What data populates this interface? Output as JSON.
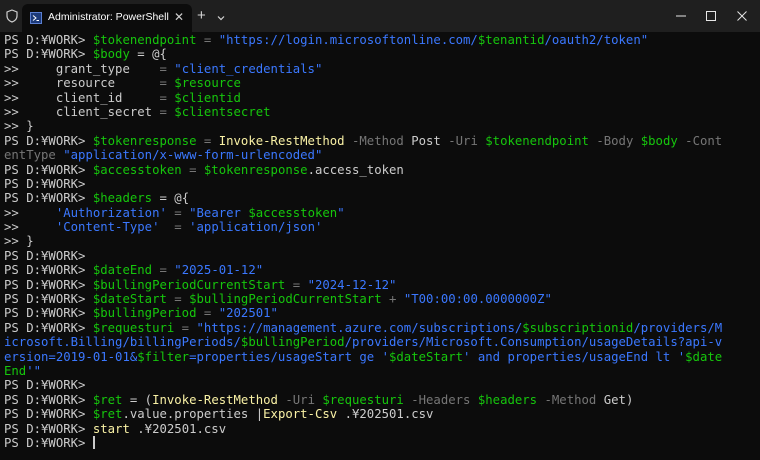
{
  "titlebar": {
    "tab_title": "Administrator: PowerShell",
    "tab_close": "✕",
    "new_tab": "+",
    "icons": {
      "shield": "shield-icon",
      "powershell": "powershell-icon",
      "dropdown": "chevron-down-icon",
      "minimize": "minimize-icon",
      "maximize": "maximize-icon",
      "close": "close-icon"
    }
  },
  "colors": {
    "background": "#0c0c0c",
    "default_text": "#cccccc",
    "variable": "#16c60c",
    "string": "#3b78ff",
    "parameter": "#767676",
    "command": "#f9f1a5",
    "operator": "#767676"
  },
  "terminal": {
    "lines": [
      [
        [
          "PS D:¥WORK> ",
          "p"
        ],
        [
          "$tokenendpoint",
          "v"
        ],
        [
          " = ",
          "o"
        ],
        [
          "\"https://login.microsoftonline.com/",
          "s"
        ],
        [
          "$tenantid",
          "v"
        ],
        [
          "/oauth2/token\"",
          "s"
        ]
      ],
      [
        [
          "PS D:¥WORK> ",
          "p"
        ],
        [
          "$body",
          "v"
        ],
        [
          " = @{",
          "t"
        ]
      ],
      [
        [
          ">>     grant_type    ",
          "t"
        ],
        [
          "= ",
          "o"
        ],
        [
          "\"client_credentials\"",
          "s"
        ]
      ],
      [
        [
          ">>     resource      ",
          "t"
        ],
        [
          "= ",
          "o"
        ],
        [
          "$resource",
          "v"
        ]
      ],
      [
        [
          ">>     client_id     ",
          "t"
        ],
        [
          "= ",
          "o"
        ],
        [
          "$clientid",
          "v"
        ]
      ],
      [
        [
          ">>     client_secret ",
          "t"
        ],
        [
          "= ",
          "o"
        ],
        [
          "$clientsecret",
          "v"
        ]
      ],
      [
        [
          ">> }",
          "t"
        ]
      ],
      [
        [
          "PS D:¥WORK> ",
          "p"
        ],
        [
          "$tokenresponse",
          "v"
        ],
        [
          " = ",
          "o"
        ],
        [
          "Invoke-RestMethod",
          "c"
        ],
        [
          " -Method ",
          "a"
        ],
        [
          "Post",
          "t"
        ],
        [
          " -Uri ",
          "a"
        ],
        [
          "$tokenendpoint",
          "v"
        ],
        [
          " -Body ",
          "a"
        ],
        [
          "$body",
          "v"
        ],
        [
          " -Cont",
          "a"
        ]
      ],
      [
        [
          "entType ",
          "a"
        ],
        [
          "\"application/x-www-form-urlencoded\"",
          "s"
        ]
      ],
      [
        [
          "PS D:¥WORK> ",
          "p"
        ],
        [
          "$accesstoken",
          "v"
        ],
        [
          " = ",
          "o"
        ],
        [
          "$tokenresponse",
          "v"
        ],
        [
          ".access_token",
          "t"
        ]
      ],
      [
        [
          "PS D:¥WORK>",
          "p"
        ]
      ],
      [
        [
          "PS D:¥WORK> ",
          "p"
        ],
        [
          "$headers",
          "v"
        ],
        [
          " = @{",
          "t"
        ]
      ],
      [
        [
          ">>     ",
          "t"
        ],
        [
          "'Authorization'",
          "s"
        ],
        [
          " = ",
          "o"
        ],
        [
          "\"Bearer ",
          "s"
        ],
        [
          "$accesstoken",
          "v"
        ],
        [
          "\"",
          "s"
        ]
      ],
      [
        [
          ">>     ",
          "t"
        ],
        [
          "'Content-Type'",
          "s"
        ],
        [
          "  = ",
          "o"
        ],
        [
          "'application/json'",
          "s"
        ]
      ],
      [
        [
          ">> }",
          "t"
        ]
      ],
      [
        [
          "PS D:¥WORK>",
          "p"
        ]
      ],
      [
        [
          "PS D:¥WORK> ",
          "p"
        ],
        [
          "$dateEnd",
          "v"
        ],
        [
          " = ",
          "o"
        ],
        [
          "\"2025-01-12\"",
          "s"
        ]
      ],
      [
        [
          "PS D:¥WORK> ",
          "p"
        ],
        [
          "$bullingPeriodCurrentStart",
          "v"
        ],
        [
          " = ",
          "o"
        ],
        [
          "\"2024-12-12\"",
          "s"
        ]
      ],
      [
        [
          "PS D:¥WORK> ",
          "p"
        ],
        [
          "$dateStart",
          "v"
        ],
        [
          " = ",
          "o"
        ],
        [
          "$bullingPeriodCurrentStart",
          "v"
        ],
        [
          " + ",
          "o"
        ],
        [
          "\"T00:00:00.0000000Z\"",
          "s"
        ]
      ],
      [
        [
          "PS D:¥WORK> ",
          "p"
        ],
        [
          "$bullingPeriod",
          "v"
        ],
        [
          " = ",
          "o"
        ],
        [
          "\"202501\"",
          "s"
        ]
      ],
      [
        [
          "PS D:¥WORK> ",
          "p"
        ],
        [
          "$requesturi",
          "v"
        ],
        [
          " = ",
          "o"
        ],
        [
          "\"https://management.azure.com/subscriptions/",
          "s"
        ],
        [
          "$subscriptionid",
          "v"
        ],
        [
          "/providers/M",
          "s"
        ]
      ],
      [
        [
          "icrosoft.Billing/billingPeriods/",
          "s"
        ],
        [
          "$bullingPeriod",
          "v"
        ],
        [
          "/providers/Microsoft.Consumption/usageDetails?api-v",
          "s"
        ]
      ],
      [
        [
          "ersion=2019-01-01&",
          "s"
        ],
        [
          "$filter",
          "v"
        ],
        [
          "=properties/usageStart ge '",
          "s"
        ],
        [
          "$dateStart",
          "v"
        ],
        [
          "' and properties/usageEnd lt '",
          "s"
        ],
        [
          "$date",
          "v"
        ]
      ],
      [
        [
          "End",
          "v"
        ],
        [
          "'\"",
          "s"
        ]
      ],
      [
        [
          "PS D:¥WORK>",
          "p"
        ]
      ],
      [
        [
          "PS D:¥WORK> ",
          "p"
        ],
        [
          "$ret",
          "v"
        ],
        [
          " = (",
          "t"
        ],
        [
          "Invoke-RestMethod",
          "c"
        ],
        [
          " -Uri ",
          "a"
        ],
        [
          "$requesturi",
          "v"
        ],
        [
          " -Headers ",
          "a"
        ],
        [
          "$headers",
          "v"
        ],
        [
          " -Method ",
          "a"
        ],
        [
          "Get",
          "t"
        ],
        [
          ")",
          "t"
        ]
      ],
      [
        [
          "PS D:¥WORK> ",
          "p"
        ],
        [
          "$ret",
          "v"
        ],
        [
          ".value.properties |",
          "t"
        ],
        [
          "Export-Csv",
          "c"
        ],
        [
          " .¥202501.csv",
          "t"
        ]
      ],
      [
        [
          "PS D:¥WORK> ",
          "p"
        ],
        [
          "start",
          "c"
        ],
        [
          " .¥202501.csv",
          "t"
        ]
      ],
      [
        [
          "PS D:¥WORK> ",
          "p"
        ]
      ]
    ]
  }
}
